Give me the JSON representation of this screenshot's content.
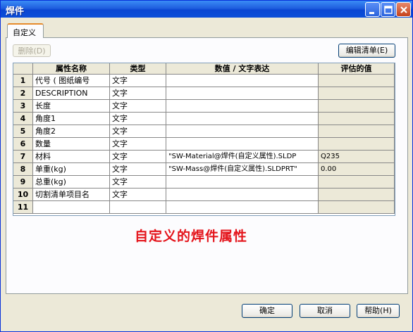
{
  "window": {
    "title": "焊件"
  },
  "tab": {
    "label": "自定义"
  },
  "toolbar": {
    "delete_label": "删除(D)",
    "edit_list_label": "编辑清单(E)"
  },
  "table": {
    "columns": [
      "属性名称",
      "类型",
      "数值 / 文字表达",
      "评估的值"
    ],
    "rows": [
      {
        "num": "1",
        "name": "代号 ( 图纸编号",
        "type": "文字",
        "expr": "",
        "value": ""
      },
      {
        "num": "2",
        "name": "DESCRIPTION",
        "type": "文字",
        "expr": "",
        "value": ""
      },
      {
        "num": "3",
        "name": "长度",
        "type": "文字",
        "expr": "",
        "value": ""
      },
      {
        "num": "4",
        "name": "角度1",
        "type": "文字",
        "expr": "",
        "value": ""
      },
      {
        "num": "5",
        "name": "角度2",
        "type": "文字",
        "expr": "",
        "value": ""
      },
      {
        "num": "6",
        "name": "数量",
        "type": "文字",
        "expr": "",
        "value": ""
      },
      {
        "num": "7",
        "name": "材料",
        "type": "文字",
        "expr": "\"SW-Material@焊件(自定义属性).SLDP",
        "value": "Q235"
      },
      {
        "num": "8",
        "name": "单重(kg)",
        "type": "文字",
        "expr": "\"SW-Mass@焊件(自定义属性).SLDPRT\"",
        "value": "0.00"
      },
      {
        "num": "9",
        "name": "总重(kg)",
        "type": "文字",
        "expr": "",
        "value": ""
      },
      {
        "num": "10",
        "name": "切割清单项目名",
        "type": "文字",
        "expr": "",
        "value": ""
      },
      {
        "num": "11",
        "name": "",
        "type": "",
        "expr": "",
        "value": ""
      }
    ]
  },
  "caption": "自定义的焊件属性",
  "footer": {
    "ok_label": "确定",
    "cancel_label": "取消",
    "help_label": "帮助(H)"
  },
  "colors": {
    "titlebar": "#0a46d3",
    "caption": "#e4141b",
    "panel_bg": "#ece9d8"
  }
}
